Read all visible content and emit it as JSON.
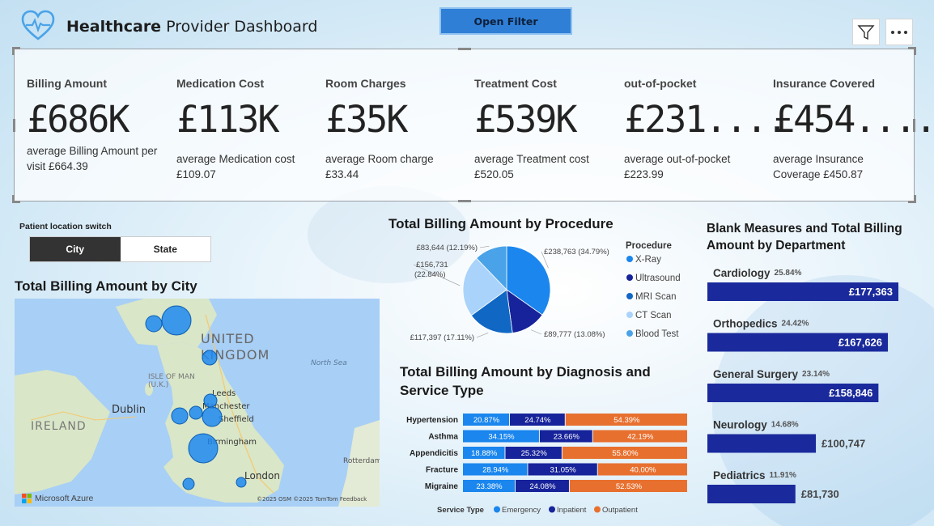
{
  "header": {
    "title_bold": "Healthcare",
    "title_rest": " Provider Dashboard",
    "open_filter_label": "Open Filter"
  },
  "kpis": [
    {
      "label": "Billing Amount",
      "value": "£686K",
      "sub": "average Billing Amount per visit £664.39"
    },
    {
      "label": "Medication Cost",
      "value": "£113K",
      "sub": "average Medication cost £109.07"
    },
    {
      "label": "Room Charges",
      "value": "£35K",
      "sub": "average Room charge £33.44"
    },
    {
      "label": "Treatment Cost",
      "value": "£539K",
      "sub": "average Treatment cost £520.05"
    },
    {
      "label": "out-of-pocket",
      "value": "£231....",
      "sub": "average out-of-pocket £223.99"
    },
    {
      "label": "Insurance Covered",
      "value": "£454....",
      "sub": "average Insurance Coverage £450.87"
    }
  ],
  "location_switch": {
    "label": "Patient location switch",
    "options": [
      "City",
      "State"
    ],
    "selected": "City"
  },
  "map": {
    "title": "Total Billing Amount by City",
    "labels": [
      "UNITED KINGDOM",
      "ISLE OF MAN (U.K.)",
      "Dublin",
      "IRELAND",
      "Leeds",
      "Manchester",
      "Sheffield",
      "Birmingham",
      "London",
      "North Sea",
      "Rotterdam"
    ],
    "attribution": "©2025 OSM ©2025 TomTom Feedback",
    "brand": "Microsoft Azure",
    "bubble_color": "#1e88f0"
  },
  "chart_data": [
    {
      "type": "pie",
      "title": "Total Billing Amount by Procedure",
      "legend_title": "Procedure",
      "legend_position": "right",
      "slices": [
        {
          "name": "X-Ray",
          "value": 238763,
          "label": "£238,763 (34.79%)",
          "color": "#1a86ee"
        },
        {
          "name": "Ultrasound",
          "value": 89777,
          "label": "£89,777 (13.08%)",
          "color": "#17239a"
        },
        {
          "name": "MRI Scan",
          "value": 117397,
          "label": "£117,397 (17.11%)",
          "color": "#1067c4"
        },
        {
          "name": "CT Scan",
          "value": 156731,
          "label": "£156,731 (22.84%)",
          "color": "#a9d3fa"
        },
        {
          "name": "Blood Test",
          "value": 83644,
          "label": "£83,644 (12.19%)",
          "color": "#4aa3e8"
        }
      ]
    },
    {
      "type": "bar",
      "orientation": "horizontal",
      "stacked": "100%",
      "title": "Total Billing Amount by Diagnosis and Service Type",
      "legend_title": "Service Type",
      "legend_position": "bottom",
      "categories": [
        "Hypertension",
        "Asthma",
        "Appendicitis",
        "Fracture",
        "Migraine"
      ],
      "series": [
        {
          "name": "Emergency",
          "color": "#1a86ee",
          "values": [
            20.87,
            34.15,
            18.88,
            28.94,
            23.38
          ]
        },
        {
          "name": "Inpatient",
          "color": "#17239a",
          "values": [
            24.74,
            23.66,
            25.32,
            31.05,
            24.08
          ]
        },
        {
          "name": "Outpatient",
          "color": "#e8702f",
          "values": [
            54.39,
            42.19,
            55.8,
            40.0,
            52.53
          ]
        }
      ]
    },
    {
      "type": "bar",
      "orientation": "horizontal",
      "title": "Blank Measures and Total Billing Amount by Department",
      "color": "#1a2a9c",
      "categories": [
        "Cardiology",
        "Orthopedics",
        "General Surgery",
        "Neurology",
        "Pediatrics"
      ],
      "percents": [
        "25.84%",
        "24.42%",
        "23.14%",
        "14.68%",
        "11.91%"
      ],
      "values": [
        177363,
        167626,
        158846,
        100747,
        81730
      ],
      "value_labels": [
        "£177,363",
        "£167,626",
        "£158,846",
        "£100,747",
        "£81,730"
      ],
      "xlim": [
        0,
        177363
      ]
    }
  ]
}
